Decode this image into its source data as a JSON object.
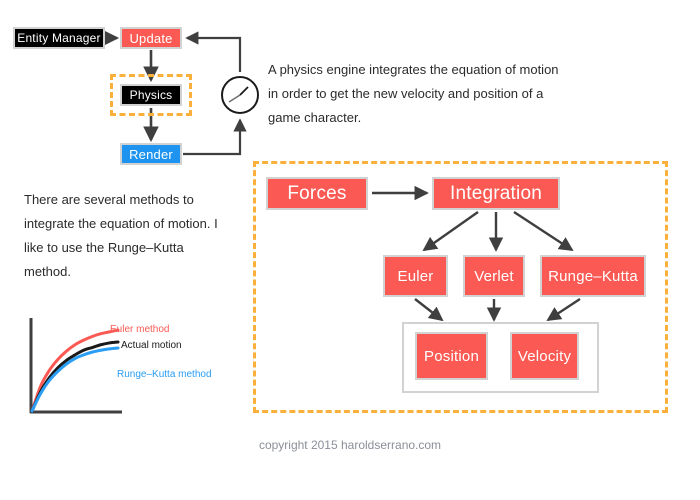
{
  "title": "Physics engine integration diagram",
  "colors": {
    "red": "#fa5a53",
    "blue": "#1e94f0",
    "black": "#000000",
    "dashed_orange": "#fbb03b",
    "box_border_gray": "#d2d2d2",
    "arrow_gray": "#3f3f3f",
    "text_dark": "#2b2b2b",
    "copyright_gray": "#8a8f98",
    "chart_euler": "#fa5a53",
    "chart_actual": "#1a1a1a",
    "chart_rk": "#2a9df4"
  },
  "pipeline": {
    "entity_manager": "Entity Manager",
    "update": "Update",
    "physics": "Physics",
    "render": "Render",
    "clock_icon": "clock-icon"
  },
  "paragraphs": {
    "physics_engine": "A physics engine integrates the equation of motion in order to get the new velocity and position of a game character.",
    "methods": "There are several methods to integrate the equation of motion.  I like to use the Runge–Kutta method."
  },
  "integration_panel": {
    "forces": "Forces",
    "integration": "Integration",
    "methods": [
      "Euler",
      "Verlet",
      "Runge–Kutta"
    ],
    "state": [
      "Position",
      "Velocity"
    ]
  },
  "chart_data": {
    "type": "line",
    "title": "",
    "xlabel": "",
    "ylabel": "",
    "xlim": [
      0,
      10
    ],
    "ylim": [
      0,
      10
    ],
    "grid": false,
    "legend_position": "right",
    "x": [
      0,
      1,
      2,
      3,
      4,
      5,
      6,
      7,
      8,
      9,
      10
    ],
    "series": [
      {
        "name": "Euler method",
        "color": "#fa5a53",
        "values": [
          0,
          2.7,
          4.4,
          5.6,
          6.5,
          7.2,
          7.7,
          8.1,
          8.4,
          8.6,
          8.8
        ]
      },
      {
        "name": "Actual motion",
        "color": "#1a1a1a",
        "values": [
          0,
          2.1,
          3.6,
          4.7,
          5.5,
          6.1,
          6.6,
          6.9,
          7.2,
          7.4,
          7.5
        ]
      },
      {
        "name": "Runge–Kutta method",
        "color": "#2a9df4",
        "values": [
          0,
          1.9,
          3.3,
          4.3,
          5.1,
          5.7,
          6.1,
          6.4,
          6.6,
          6.75,
          6.85
        ]
      }
    ]
  },
  "footer": {
    "copyright": "copyright 2015 haroldserrano.com"
  }
}
